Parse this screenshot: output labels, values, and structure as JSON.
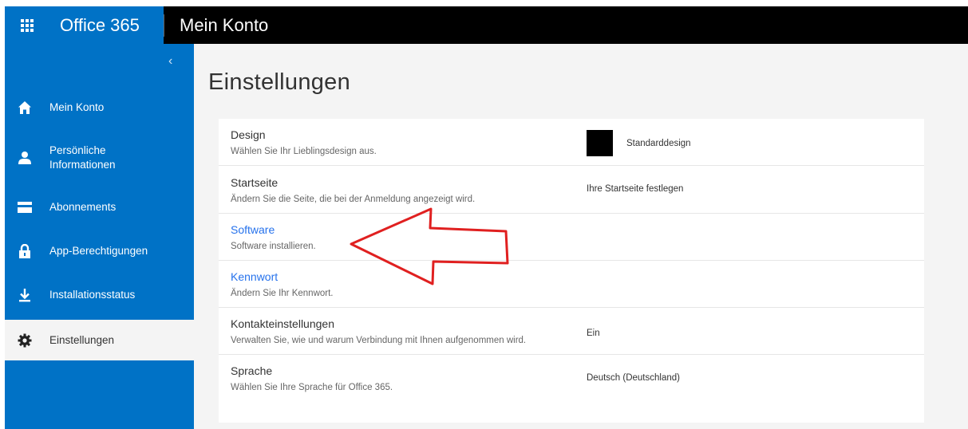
{
  "header": {
    "launcher_icon": "app-launcher-icon",
    "brand": "Office 365",
    "app_title": "Mein Konto"
  },
  "sidebar": {
    "collapse_glyph": "‹",
    "items": [
      {
        "label": "Mein Konto",
        "icon": "home-icon"
      },
      {
        "label": "Persönliche\nInformationen",
        "icon": "person-icon"
      },
      {
        "label": "Abonnements",
        "icon": "card-icon"
      },
      {
        "label": "App-Berechtigungen",
        "icon": "lock-icon"
      },
      {
        "label": "Installationsstatus",
        "icon": "download-icon"
      },
      {
        "label": "Einstellungen",
        "icon": "gear-icon"
      }
    ]
  },
  "main": {
    "title": "Einstellungen",
    "settings": [
      {
        "title": "Design",
        "desc": "Wählen Sie Ihr Lieblingsdesign aus.",
        "value": "Standarddesign"
      },
      {
        "title": "Startseite",
        "desc": "Ändern Sie die Seite, die bei der Anmeldung angezeigt wird.",
        "value": "Ihre Startseite festlegen"
      },
      {
        "title": "Software",
        "desc": "Software installieren.",
        "value": ""
      },
      {
        "title": "Kennwort",
        "desc": "Ändern Sie Ihr Kennwort.",
        "value": ""
      },
      {
        "title": "Kontakteinstellungen",
        "desc": "Verwalten Sie, wie und warum Verbindung mit Ihnen aufgenommen wird.",
        "value": "Ein"
      },
      {
        "title": "Sprache",
        "desc": "Wählen Sie Ihre Sprache für Office 365.",
        "value": "Deutsch (Deutschland)"
      }
    ]
  },
  "colors": {
    "brand_blue": "#0072c6",
    "link_blue": "#2672ec",
    "annotation_red": "#e02020"
  }
}
